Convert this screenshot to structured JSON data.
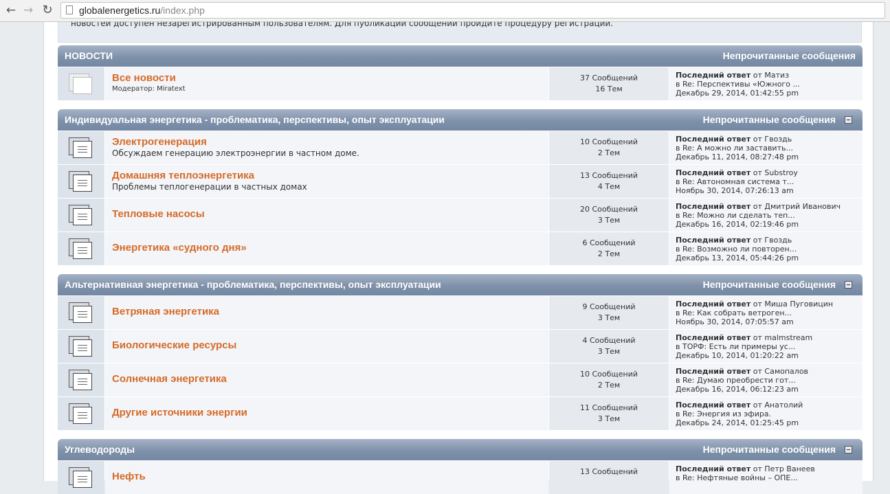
{
  "browser": {
    "url_host": "globalenergetics.ru",
    "url_path": "/index.php"
  },
  "notice": "новостей доступен незарегистрированным пользователям. Для публикации сообщений пройдите процедуру регистрации.",
  "labels": {
    "last_reply": "Последний ответ",
    "from": "от",
    "in": "в"
  },
  "categories": [
    {
      "title": "НОВОСТИ",
      "unread": "Непрочитанные сообщения",
      "boards": [
        {
          "name": "Все новости",
          "desc": "",
          "moderator": "Модератор: Miratext",
          "posts": "37 Сообщений",
          "topics": "16 Тем",
          "last_user": "Матиз",
          "last_topic": "Re: Перспективы «Южного ...",
          "last_date": "Декабрь 29, 2014, 01:42:55 pm"
        }
      ]
    },
    {
      "title": "Индивидуальная энергетика - проблематика, перспективы, опыт эксплуатации",
      "unread": "Непрочитанные сообщения",
      "boards": [
        {
          "name": "Электрогенерация",
          "desc": "Обсуждаем генерацию электроэнергии в частном доме.",
          "posts": "10 Сообщений",
          "topics": "2 Тем",
          "last_user": "Гвоздь",
          "last_topic": "Re: А можно ли заставить...",
          "last_date": "Декабрь 11, 2014, 08:27:48 pm"
        },
        {
          "name": "Домашняя теплоэнергетика",
          "desc": "Проблемы теплогенерации в частных домах",
          "posts": "13 Сообщений",
          "topics": "4 Тем",
          "last_user": "Substroy",
          "last_topic": "Re: Автономная система т...",
          "last_date": "Ноябрь 30, 2014, 07:26:13 am"
        },
        {
          "name": "Тепловые насосы",
          "desc": "",
          "posts": "20 Сообщений",
          "topics": "3 Тем",
          "last_user": "Дмитрий Иванович",
          "last_topic": "Re: Можно ли сделать теп...",
          "last_date": "Декабрь 16, 2014, 02:19:46 pm"
        },
        {
          "name": "Энергетика «судного дня»",
          "desc": "",
          "posts": "6 Сообщений",
          "topics": "2 Тем",
          "last_user": "Гвоздь",
          "last_topic": "Re: Возможно ли повторен...",
          "last_date": "Декабрь 13, 2014, 05:44:26 pm"
        }
      ]
    },
    {
      "title": "Альтернативная энергетика - проблематика, перспективы, опыт эксплуатации",
      "unread": "Непрочитанные сообщения",
      "boards": [
        {
          "name": "Ветряная энергетика",
          "desc": "",
          "posts": "9 Сообщений",
          "topics": "3 Тем",
          "last_user": "Миша Пуговицин",
          "last_topic": "Re: Как собрать ветроген...",
          "last_date": "Ноябрь 30, 2014, 07:05:57 am"
        },
        {
          "name": "Биологические ресурсы",
          "desc": "",
          "posts": "4 Сообщений",
          "topics": "3 Тем",
          "last_user": "malmstream",
          "last_topic": "ТОРФ: Есть ли примеры ус...",
          "last_date": "Декабрь 10, 2014, 01:20:22 am"
        },
        {
          "name": "Солнечная энергетика",
          "desc": "",
          "posts": "10 Сообщений",
          "topics": "2 Тем",
          "last_user": "Самопалов",
          "last_topic": "Re: Думаю преобрести гот...",
          "last_date": "Декабрь 16, 2014, 06:12:23 am"
        },
        {
          "name": "Другие источники энергии",
          "desc": "",
          "posts": "11 Сообщений",
          "topics": "3 Тем",
          "last_user": "Анатолий",
          "last_topic": "Re: Энергия из эфира.",
          "last_date": "Декабрь 24, 2014, 01:25:45 pm"
        }
      ]
    },
    {
      "title": "Углеводороды",
      "unread": "Непрочитанные сообщения",
      "boards": [
        {
          "name": "Нефть",
          "desc": "",
          "posts": "13 Сообщений",
          "topics": "",
          "last_user": "Петр Ванеев",
          "last_topic": "Re: Нефтяные войны – ОПЕ...",
          "last_date": ""
        }
      ]
    }
  ]
}
